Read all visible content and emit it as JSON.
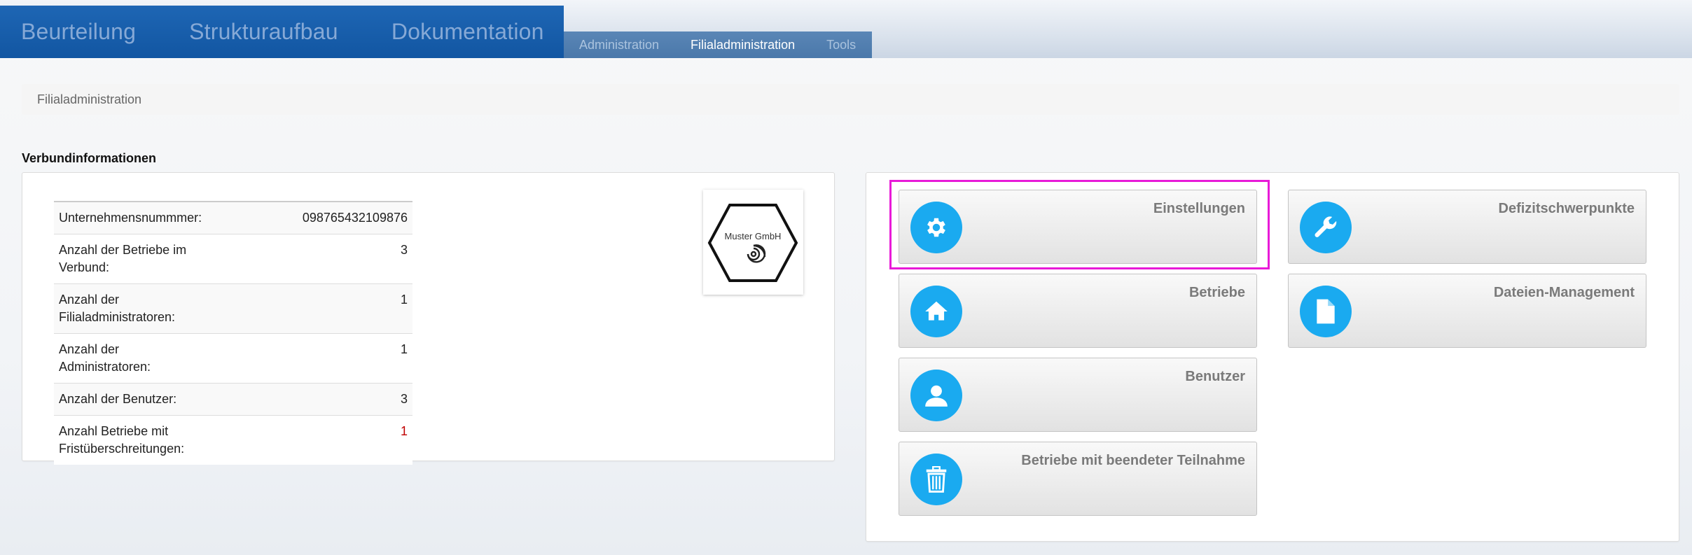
{
  "main_nav": {
    "tabs": [
      {
        "label": "Beurteilung"
      },
      {
        "label": "Strukturaufbau"
      },
      {
        "label": "Dokumentation"
      }
    ]
  },
  "sub_nav": {
    "tabs": [
      {
        "label": "Administration",
        "active": false
      },
      {
        "label": "Filialadministration",
        "active": true
      },
      {
        "label": "Tools",
        "active": false
      }
    ]
  },
  "breadcrumb": "Filialadministration",
  "section_title": "Verbundinformationen",
  "info": {
    "rows": [
      {
        "label": "Unternehmensnummmer:",
        "value": "098765432109876"
      },
      {
        "label": "Anzahl der Betriebe im Verbund:",
        "value": "3"
      },
      {
        "label": "Anzahl der Filialadministratoren:",
        "value": "1"
      },
      {
        "label": "Anzahl der Administratoren:",
        "value": "1"
      },
      {
        "label": "Anzahl der Benutzer:",
        "value": "3"
      },
      {
        "label": "Anzahl Betriebe mit Fristüberschreitungen:",
        "value": "1"
      }
    ]
  },
  "logo": {
    "text": "Muster GmbH"
  },
  "tiles": {
    "einstellungen": {
      "label": "Einstellungen",
      "icon": "gear-icon"
    },
    "defizit": {
      "label": "Defizitschwerpunkte",
      "icon": "wrench-icon"
    },
    "betriebe": {
      "label": "Betriebe",
      "icon": "home-icon"
    },
    "dateien": {
      "label": "Dateien-Management",
      "icon": "file-icon"
    },
    "benutzer": {
      "label": "Benutzer",
      "icon": "user-icon"
    },
    "beendet": {
      "label": "Betriebe mit beendeter Teilnahme",
      "icon": "trash-icon"
    }
  },
  "colors": {
    "nav_blue": "#1256a2",
    "accent_icon": "#1aaaf0",
    "highlight": "#e81ad8",
    "alert": "#c00000"
  }
}
